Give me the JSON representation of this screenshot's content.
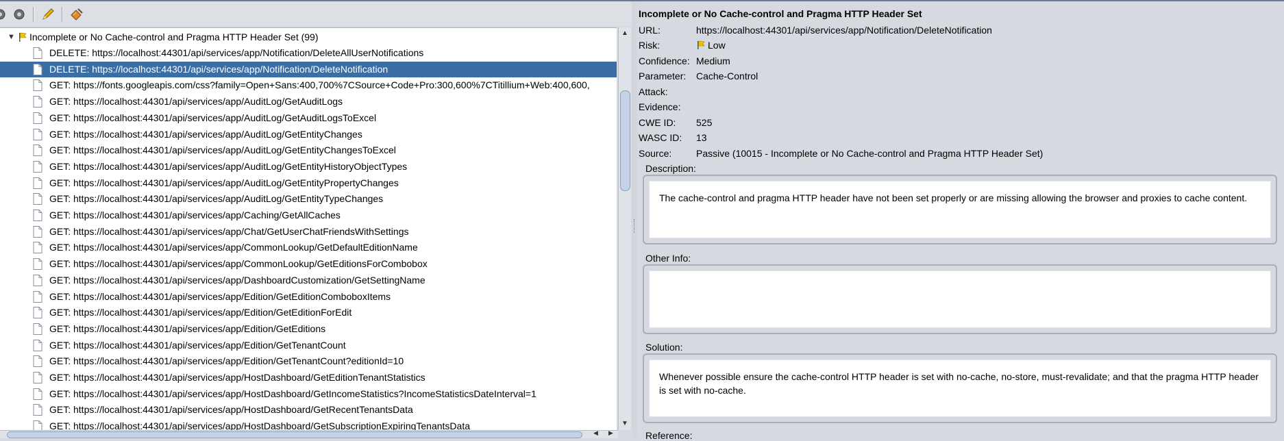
{
  "tree": {
    "root": {
      "label": "Incomplete or No Cache-control and Pragma HTTP Header Set (99)"
    },
    "items": [
      "DELETE: https://localhost:44301/api/services/app/Notification/DeleteAllUserNotifications",
      "DELETE: https://localhost:44301/api/services/app/Notification/DeleteNotification",
      "GET: https://fonts.googleapis.com/css?family=Open+Sans:400,700%7CSource+Code+Pro:300,600%7CTitillium+Web:400,600,",
      "GET: https://localhost:44301/api/services/app/AuditLog/GetAuditLogs",
      "GET: https://localhost:44301/api/services/app/AuditLog/GetAuditLogsToExcel",
      "GET: https://localhost:44301/api/services/app/AuditLog/GetEntityChanges",
      "GET: https://localhost:44301/api/services/app/AuditLog/GetEntityChangesToExcel",
      "GET: https://localhost:44301/api/services/app/AuditLog/GetEntityHistoryObjectTypes",
      "GET: https://localhost:44301/api/services/app/AuditLog/GetEntityPropertyChanges",
      "GET: https://localhost:44301/api/services/app/AuditLog/GetEntityTypeChanges",
      "GET: https://localhost:44301/api/services/app/Caching/GetAllCaches",
      "GET: https://localhost:44301/api/services/app/Chat/GetUserChatFriendsWithSettings",
      "GET: https://localhost:44301/api/services/app/CommonLookup/GetDefaultEditionName",
      "GET: https://localhost:44301/api/services/app/CommonLookup/GetEditionsForCombobox",
      "GET: https://localhost:44301/api/services/app/DashboardCustomization/GetSettingName",
      "GET: https://localhost:44301/api/services/app/Edition/GetEditionComboboxItems",
      "GET: https://localhost:44301/api/services/app/Edition/GetEditionForEdit",
      "GET: https://localhost:44301/api/services/app/Edition/GetEditions",
      "GET: https://localhost:44301/api/services/app/Edition/GetTenantCount",
      "GET: https://localhost:44301/api/services/app/Edition/GetTenantCount?editionId=10",
      "GET: https://localhost:44301/api/services/app/HostDashboard/GetEditionTenantStatistics",
      "GET: https://localhost:44301/api/services/app/HostDashboard/GetIncomeStatistics?IncomeStatisticsDateInterval=1",
      "GET: https://localhost:44301/api/services/app/HostDashboard/GetRecentTenantsData",
      "GET: https://localhost:44301/api/services/app/HostDashboard/GetSubscriptionExpiringTenantsData"
    ],
    "selected_index": 1
  },
  "detail": {
    "title": "Incomplete or No Cache-control and Pragma HTTP Header Set",
    "fields": {
      "url": {
        "label": "URL:",
        "value": "https://localhost:44301/api/services/app/Notification/DeleteNotification"
      },
      "risk": {
        "label": "Risk:",
        "value": "Low"
      },
      "confidence": {
        "label": "Confidence:",
        "value": "Medium"
      },
      "parameter": {
        "label": "Parameter:",
        "value": "Cache-Control"
      },
      "attack": {
        "label": "Attack:",
        "value": ""
      },
      "evidence": {
        "label": "Evidence:",
        "value": ""
      },
      "cwe": {
        "label": "CWE ID:",
        "value": "525"
      },
      "wasc": {
        "label": "WASC ID:",
        "value": "13"
      },
      "source": {
        "label": "Source:",
        "value": "Passive (10015 - Incomplete or No Cache-control and Pragma HTTP Header Set)"
      }
    },
    "description": {
      "label": "Description:",
      "text": "The cache-control and pragma HTTP header have not been set properly or are missing allowing the browser and proxies to cache content."
    },
    "other_info": {
      "label": "Other Info:",
      "text": ""
    },
    "solution": {
      "label": "Solution:",
      "text": "Whenever possible ensure the cache-control HTTP header is set with no-cache, no-store, must-revalidate; and that the pragma HTTP header is set with no-cache."
    },
    "reference": {
      "label": "Reference:"
    }
  },
  "colors": {
    "selection": "#3a6ea5",
    "flag": "#f2c200",
    "background": "#d6d9df"
  },
  "icons": [
    "gear-icon",
    "gear-icon",
    "pencil-icon",
    "broom-icon",
    "document-icon",
    "flag-icon",
    "expand-arrow-icon"
  ]
}
